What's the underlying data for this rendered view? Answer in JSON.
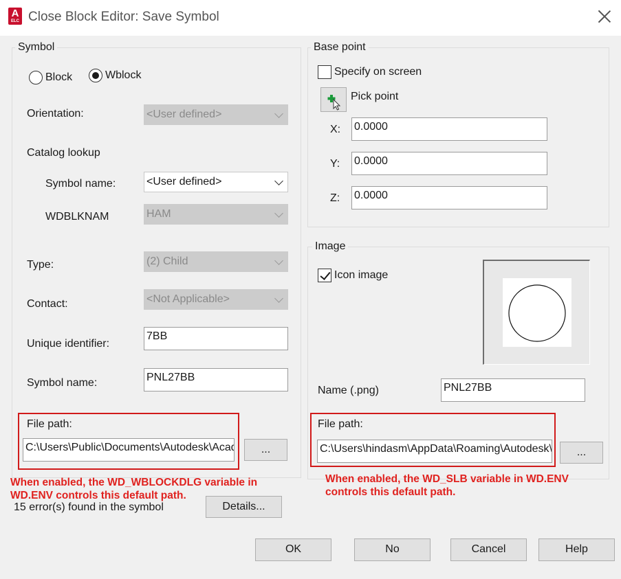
{
  "window": {
    "title": "Close Block Editor: Save Symbol",
    "app_icon_letter": "A",
    "app_icon_sub": "ELC"
  },
  "symbol": {
    "group_label": "Symbol",
    "block_label": "Block",
    "wblock_label": "Wblock",
    "selected_mode": "Wblock",
    "orientation_label": "Orientation:",
    "orientation_value": "<User defined>",
    "catalog_lookup_label": "Catalog lookup",
    "symbol_name_combo_label": "Symbol name:",
    "symbol_name_combo_value": "<User defined>",
    "wdblknam_label": "WDBLKNAM",
    "wdblknam_value": "HAM",
    "type_label": "Type:",
    "type_value": "(2) Child",
    "contact_label": "Contact:",
    "contact_value": "<Not Applicable>",
    "unique_id_label": "Unique identifier:",
    "unique_id_value": "7BB",
    "symbol_name_label": "Symbol name:",
    "symbol_name_value": "PNL27BB",
    "file_path_label": "File path:",
    "file_path_value": "C:\\Users\\Public\\Documents\\Autodesk\\Acad",
    "browse_label": "..."
  },
  "base_point": {
    "group_label": "Base point",
    "specify_label": "Specify on screen",
    "specify_checked": false,
    "pick_point_label": "Pick point",
    "x_label": "X:",
    "x_value": "0.0000",
    "y_label": "Y:",
    "y_value": "0.0000",
    "z_label": "Z:",
    "z_value": "0.0000"
  },
  "image": {
    "group_label": "Image",
    "icon_image_label": "Icon image",
    "icon_image_checked": true,
    "name_label": "Name (.png)",
    "name_value": "PNL27BB",
    "file_path_label": "File path:",
    "file_path_value": "C:\\Users\\hindasm\\AppData\\Roaming\\Autodesk\\",
    "browse_label": "..."
  },
  "annotations": {
    "left_note_line1": "When enabled, the WD_WBLOCKDLG variable in",
    "left_note_line2": "WD.ENV controls this default path.",
    "right_note_line1": "When enabled, the WD_SLB variable in WD.ENV",
    "right_note_line2": "controls this default path.",
    "highlight_color": "#d11a1a"
  },
  "status": {
    "errors_text": "15 error(s) found in the symbol",
    "details_label": "Details..."
  },
  "footer": {
    "ok_label": "OK",
    "no_label": "No",
    "cancel_label": "Cancel",
    "help_label": "Help"
  }
}
